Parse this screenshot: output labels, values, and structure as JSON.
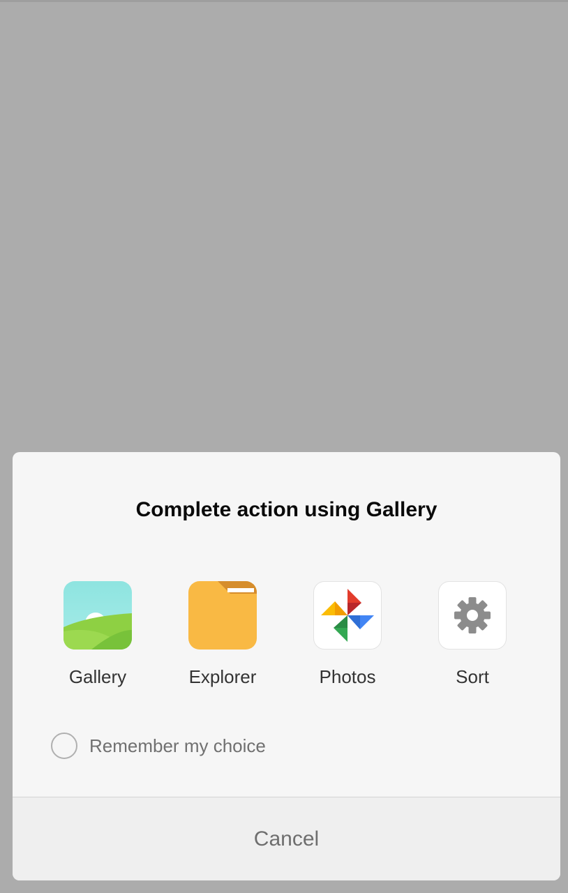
{
  "dialog": {
    "title": "Complete action using Gallery",
    "apps": [
      {
        "label": "Gallery",
        "icon": "gallery-icon"
      },
      {
        "label": "Explorer",
        "icon": "folder-icon"
      },
      {
        "label": "Photos",
        "icon": "pinwheel-icon"
      },
      {
        "label": "Sort",
        "icon": "gear-icon"
      }
    ],
    "remember_label": "Remember my choice",
    "remember_checked": false,
    "cancel_label": "Cancel"
  },
  "colors": {
    "scrim": "#acacac",
    "dialog_background": "#f6f6f6",
    "folder_accent": "#f9b944"
  }
}
